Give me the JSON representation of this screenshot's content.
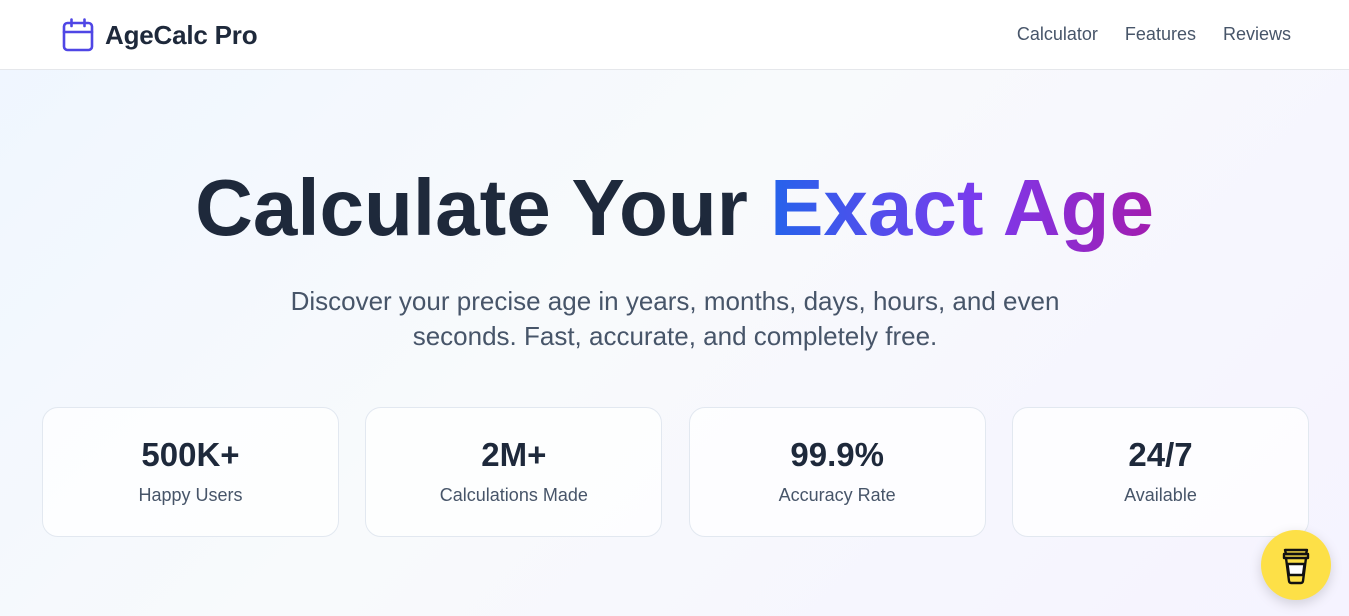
{
  "header": {
    "brand": "AgeCalc Pro",
    "brand_icon": "calendar-icon",
    "nav": [
      "Calculator",
      "Features",
      "Reviews"
    ]
  },
  "hero": {
    "title_plain": "Calculate Your ",
    "title_highlight": "Exact Age",
    "subtitle": "Discover your precise age in years, months, days, hours, and even seconds. Fast, accurate, and completely free."
  },
  "stats": [
    {
      "value": "500K+",
      "label": "Happy Users"
    },
    {
      "value": "2M+",
      "label": "Calculations Made"
    },
    {
      "value": "99.9%",
      "label": "Accuracy Rate"
    },
    {
      "value": "24/7",
      "label": "Available"
    }
  ],
  "floating_button": {
    "icon": "coffee-cup-icon",
    "color": "#fde047"
  },
  "colors": {
    "accent_start": "#2563eb",
    "accent_end": "#9333ea",
    "text_dark": "#1e293b",
    "text_muted": "#475569"
  }
}
